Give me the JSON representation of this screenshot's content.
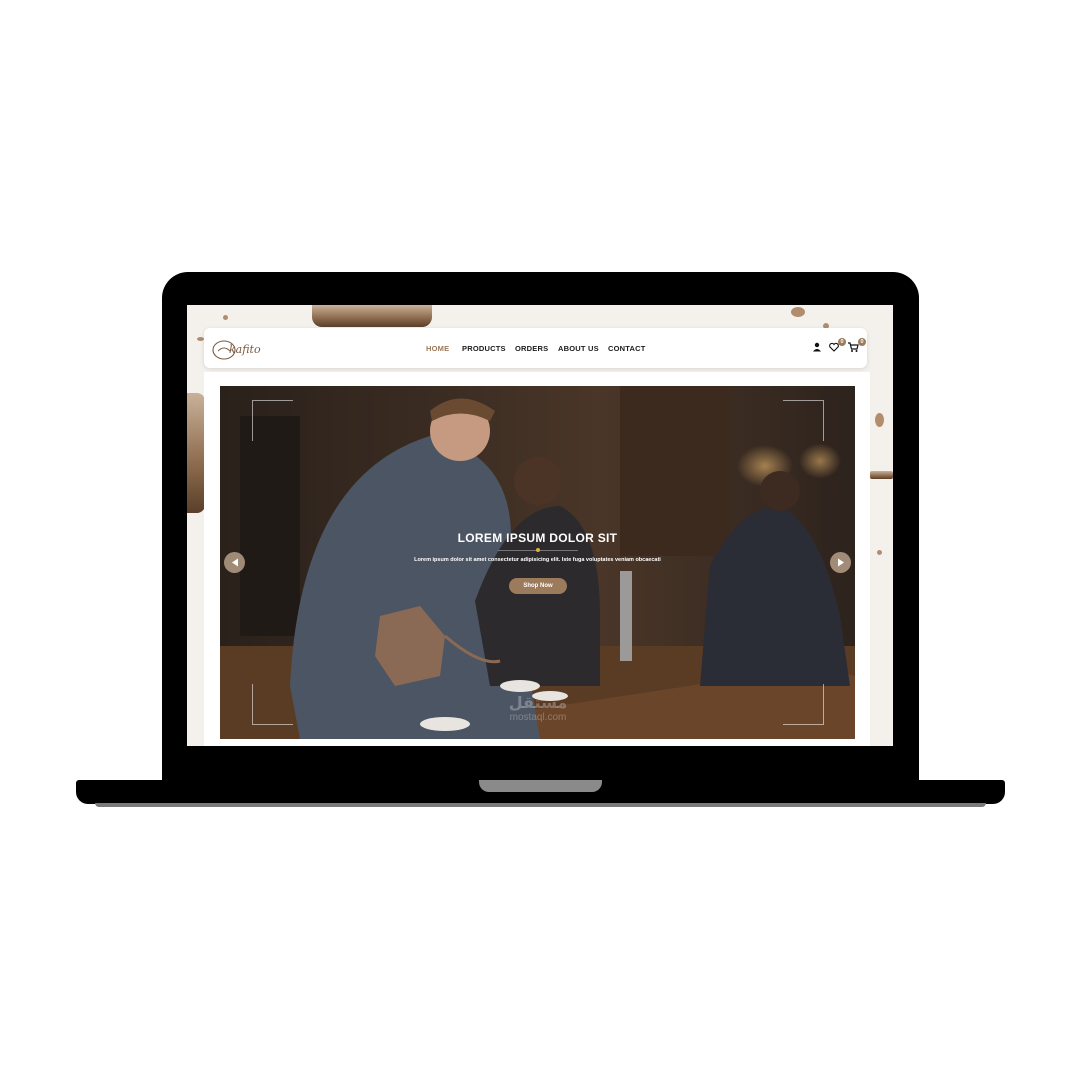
{
  "nav": {
    "logo_text": "kafito",
    "items": [
      {
        "label": "HOME",
        "active": true
      },
      {
        "label": "PRODUCTS",
        "active": false
      },
      {
        "label": "ORDERS",
        "active": false
      },
      {
        "label": "ABOUT US",
        "active": false
      },
      {
        "label": "CONTACT",
        "active": false
      }
    ],
    "icons": [
      "user-icon",
      "heart-icon",
      "cart-icon"
    ],
    "wishlist_count": "0",
    "cart_count": "0"
  },
  "hero": {
    "title": "LOREM IPSUM DOLOR SIT",
    "subtitle": "Lorem ipsum dolor sit amet consectetur adipisicing elit. Iste fuga voluptates veniam obcaecati",
    "button_label": "Shop Now",
    "prev_icon": "arrow-left-icon",
    "next_icon": "arrow-right-icon"
  },
  "watermark": {
    "arabic": "مستقل",
    "latin": "mostaql.com"
  },
  "colors": {
    "accent": "#9c7a5c",
    "dot": "#e2b13a",
    "device": "#000000"
  }
}
